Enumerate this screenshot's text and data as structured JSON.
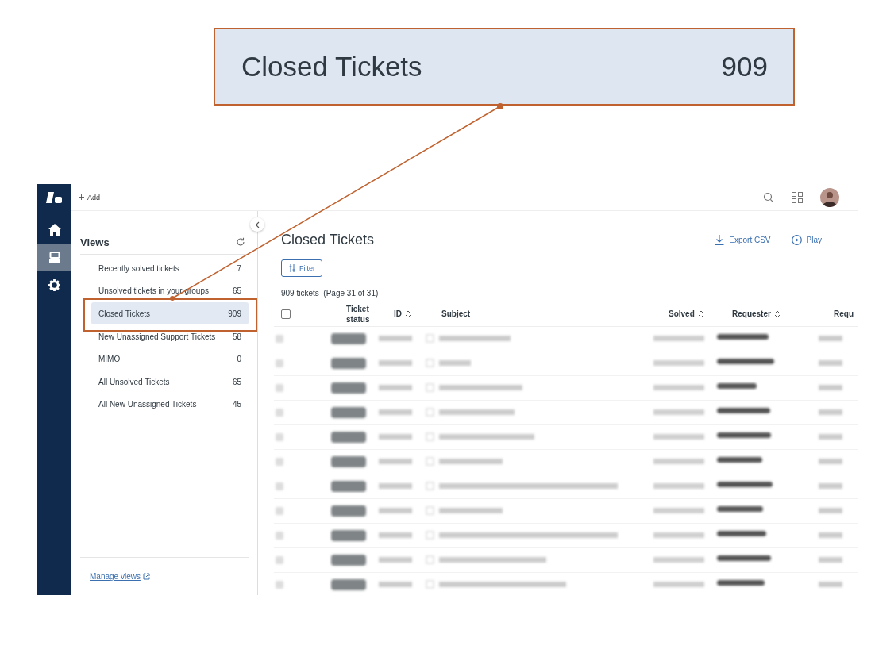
{
  "callout": {
    "title": "Closed Tickets",
    "count": "909"
  },
  "nav": [
    {
      "kind": "home",
      "selected": false
    },
    {
      "kind": "views",
      "selected": true
    },
    {
      "kind": "settings",
      "selected": false
    }
  ],
  "topbar": {
    "add": "Add"
  },
  "views": {
    "title": "Views",
    "items": [
      {
        "label": "Recently solved tickets",
        "count": "7",
        "selected": false
      },
      {
        "label": "Unsolved tickets in your groups",
        "count": "65",
        "selected": false
      },
      {
        "label": "Closed Tickets",
        "count": "909",
        "selected": true
      },
      {
        "label": "New Unassigned Support Tickets",
        "count": "58",
        "selected": false
      },
      {
        "label": "MIMO",
        "count": "0",
        "selected": false
      },
      {
        "label": "All Unsolved Tickets",
        "count": "65",
        "selected": false
      },
      {
        "label": "All New Unassigned Tickets",
        "count": "45",
        "selected": false
      }
    ],
    "manage_link": "Manage views"
  },
  "main": {
    "title": "Closed Tickets",
    "actions": [
      {
        "kind": "export",
        "label": "Export CSV"
      },
      {
        "kind": "play",
        "label": "Play"
      }
    ],
    "select_all": {
      "checked": false
    },
    "filter": "Filter",
    "summary": "909 tickets  (Page 31 of 31)",
    "columns": [
      {
        "label": "Ticket status",
        "sortable": false
      },
      {
        "label": "ID",
        "sortable": true
      },
      {
        "label": "Subject",
        "sortable": false
      },
      {
        "label": "Solved",
        "sortable": true
      },
      {
        "label": "Requester",
        "sortable": true
      },
      {
        "label": "Requ"
      }
    ],
    "rows": [
      {
        "kind": "blurred"
      },
      {
        "kind": "blurred"
      },
      {
        "kind": "blurred"
      },
      {
        "kind": "blurred"
      },
      {
        "kind": "blurred"
      },
      {
        "kind": "blurred"
      },
      {
        "kind": "blurred"
      },
      {
        "kind": "blurred"
      },
      {
        "kind": "blurred"
      },
      {
        "kind": "blurred"
      },
      {
        "kind": "blurred"
      }
    ]
  }
}
